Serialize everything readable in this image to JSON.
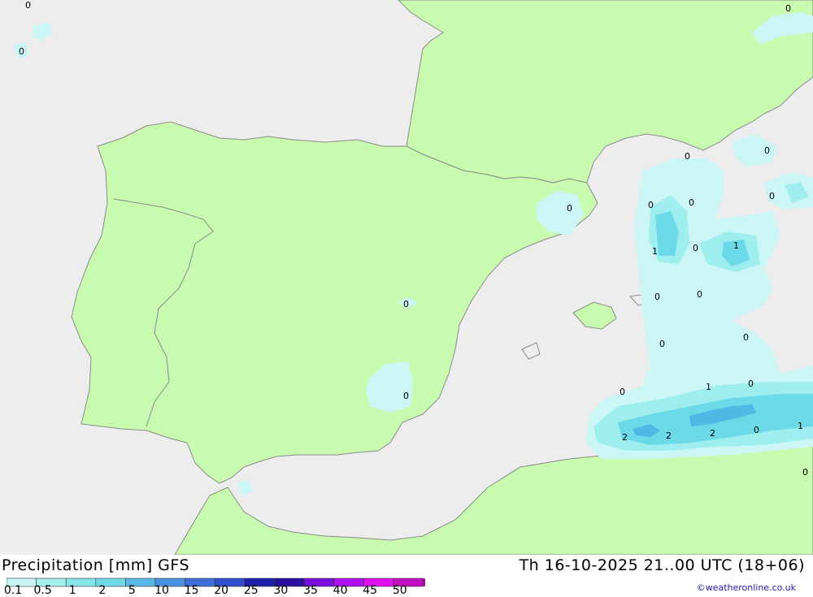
{
  "map": {
    "contour_labels": [
      "0",
      "0",
      "0",
      "0",
      "0",
      "0",
      "0",
      "0",
      "1",
      "0",
      "1",
      "0",
      "0",
      "0",
      "0",
      "0",
      "0",
      "1",
      "0",
      "0",
      "2",
      "2",
      "2",
      "0",
      "1",
      "0",
      "0"
    ]
  },
  "footer": {
    "title": "Precipitation [mm] GFS",
    "timestamp": "Th 16-10-2025 21..00 UTC (18+06)",
    "credit": "©weatheronline.co.uk"
  },
  "legend": {
    "ticks": [
      "0.1",
      "0.5",
      "1",
      "2",
      "5",
      "10",
      "15",
      "20",
      "25",
      "30",
      "35",
      "40",
      "45",
      "50"
    ],
    "colors": [
      "#c8f5f5",
      "#a6f0f0",
      "#86e6ea",
      "#6fd8e4",
      "#5ab8e8",
      "#4b92e2",
      "#3c6fd8",
      "#2f4fcc",
      "#1c22a8",
      "#2a0fa0",
      "#7a10e0",
      "#b010f0",
      "#e010f0",
      "#c010c0",
      "#9a0a9a"
    ]
  },
  "colors": {
    "sea": "#ededed",
    "land": "#c8fbaf",
    "coast": "#8a8a8a",
    "precip_light": "#ccf6f6",
    "precip_mid": "#9eeef0",
    "precip_high": "#6cd9e8",
    "precip_peak": "#4fb8e4"
  }
}
